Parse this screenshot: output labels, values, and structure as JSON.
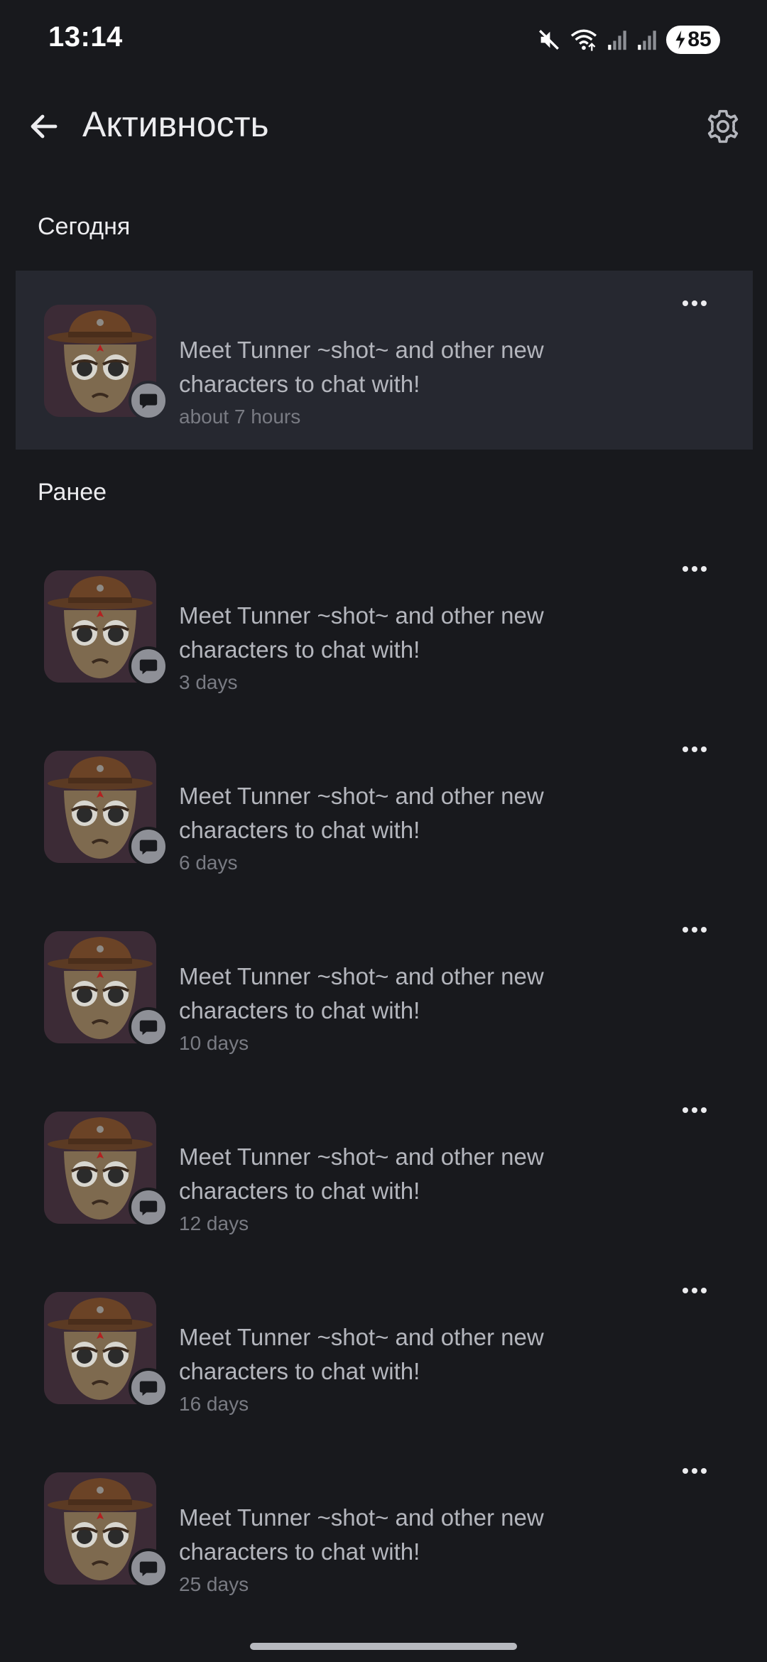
{
  "status_bar": {
    "time": "13:14",
    "battery": "85",
    "icons": [
      "mute-icon",
      "wifi-icon",
      "signal-icon",
      "signal-icon",
      "battery-charging-icon"
    ]
  },
  "header": {
    "title": "Активность",
    "back_icon": "arrow-left-icon",
    "settings_icon": "gear-icon"
  },
  "sections": {
    "today": "Сегодня",
    "earlier": "Ранее"
  },
  "notifications": [
    {
      "text": "Meet Tunner ~shot~ and other new characters to chat with!",
      "time": "about 7 hours"
    },
    {
      "text": "Meet Tunner ~shot~ and other new characters to chat with!",
      "time": "3 days"
    },
    {
      "text": "Meet Tunner ~shot~ and other new characters to chat with!",
      "time": "6 days"
    },
    {
      "text": "Meet Tunner ~shot~ and other new characters to chat with!",
      "time": "10 days"
    },
    {
      "text": "Meet Tunner ~shot~ and other new characters to chat with!",
      "time": "12 days"
    },
    {
      "text": "Meet Tunner ~shot~ and other new characters to chat with!",
      "time": "16 days"
    },
    {
      "text": "Meet Tunner ~shot~ and other new characters to chat with!",
      "time": "25 days"
    }
  ],
  "colors": {
    "background": "#18191d",
    "highlight": "#262830",
    "text": "#ececef",
    "secondary_text": "#b4b6bd",
    "muted_text": "#797b83",
    "badge": "#8e9097"
  }
}
